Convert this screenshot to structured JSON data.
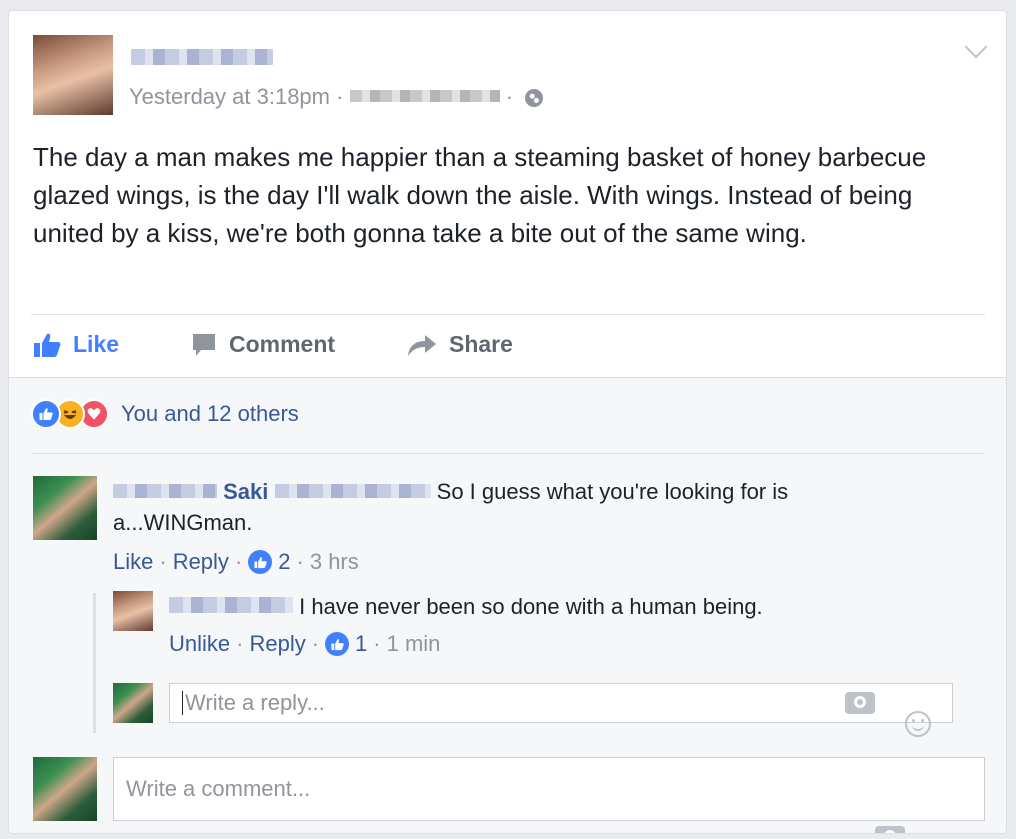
{
  "post": {
    "timestamp": "Yesterday at 3:18pm",
    "separator": "·",
    "privacy_icon": "globe-icon",
    "options_icon": "chevron-down-icon",
    "text": "The day a man makes me happier than a steaming basket of honey barbecue glazed wings, is the day I'll walk down the aisle. With wings. Instead of being united by a kiss, we're both gonna take a bite out of the same wing."
  },
  "actions": {
    "like": "Like",
    "comment": "Comment",
    "share": "Share"
  },
  "reactions": {
    "icons": [
      "like-icon",
      "haha-icon",
      "love-icon"
    ],
    "summary": "You and 12 others"
  },
  "comments": [
    {
      "name": "Saki",
      "text": "So I guess what you're looking for is a...WINGman.",
      "like_label": "Like",
      "reply_label": "Reply",
      "like_count": "2",
      "time": "3 hrs",
      "replies": [
        {
          "text": "I have never been so done with a human being.",
          "like_label": "Unlike",
          "reply_label": "Reply",
          "like_count": "1",
          "time": "1 min"
        }
      ]
    }
  ],
  "reply_input": {
    "placeholder": "Write a reply..."
  },
  "comment_input": {
    "placeholder": "Write a comment..."
  },
  "colors": {
    "link": "#385898",
    "like_blue": "#4080ff",
    "meta_gray": "#90949c"
  }
}
